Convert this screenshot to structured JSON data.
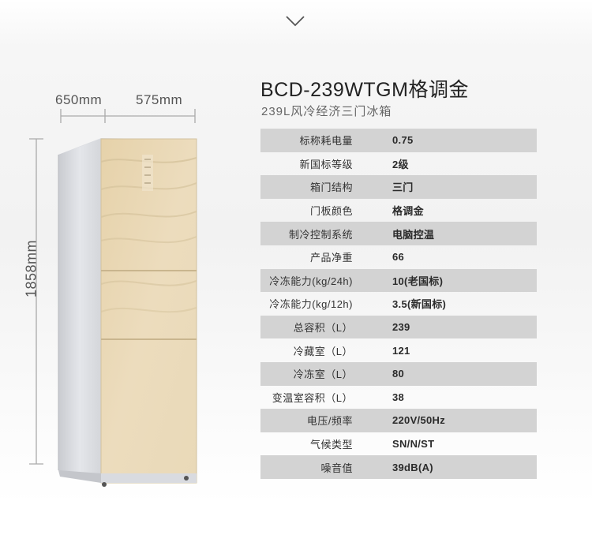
{
  "product": {
    "title": "BCD-239WTGM格调金",
    "subtitle": "239L风冷经济三门冰箱"
  },
  "dimensions": {
    "depth": "650mm",
    "width": "575mm",
    "height": "1858mm"
  },
  "icons": {
    "top": "chevron-down-icon"
  },
  "colors": {
    "row_shade": "#d3d3d3",
    "fridge_gold": "#e8d8b8"
  },
  "specs": [
    {
      "label": "标称耗电量",
      "value": "0.75"
    },
    {
      "label": "新国标等级",
      "value": "2级"
    },
    {
      "label": "箱门结构",
      "value": "三门"
    },
    {
      "label": "门板颜色",
      "value": "格调金"
    },
    {
      "label": "制冷控制系统",
      "value": "电脑控温"
    },
    {
      "label": "产品净重",
      "value": "66"
    },
    {
      "label": "冷冻能力(kg/24h)",
      "value": "10(老国标)"
    },
    {
      "label": "冷冻能力(kg/12h)",
      "value": "3.5(新国标)"
    },
    {
      "label": "总容积（L）",
      "value": "239"
    },
    {
      "label": "冷藏室（L）",
      "value": "121"
    },
    {
      "label": "冷冻室（L）",
      "value": "80"
    },
    {
      "label": "变温室容积（L）",
      "value": "38"
    },
    {
      "label": "电压/频率",
      "value": "220V/50Hz"
    },
    {
      "label": "气候类型",
      "value": "SN/N/ST"
    },
    {
      "label": "噪音值",
      "value": "39dB(A)"
    }
  ]
}
